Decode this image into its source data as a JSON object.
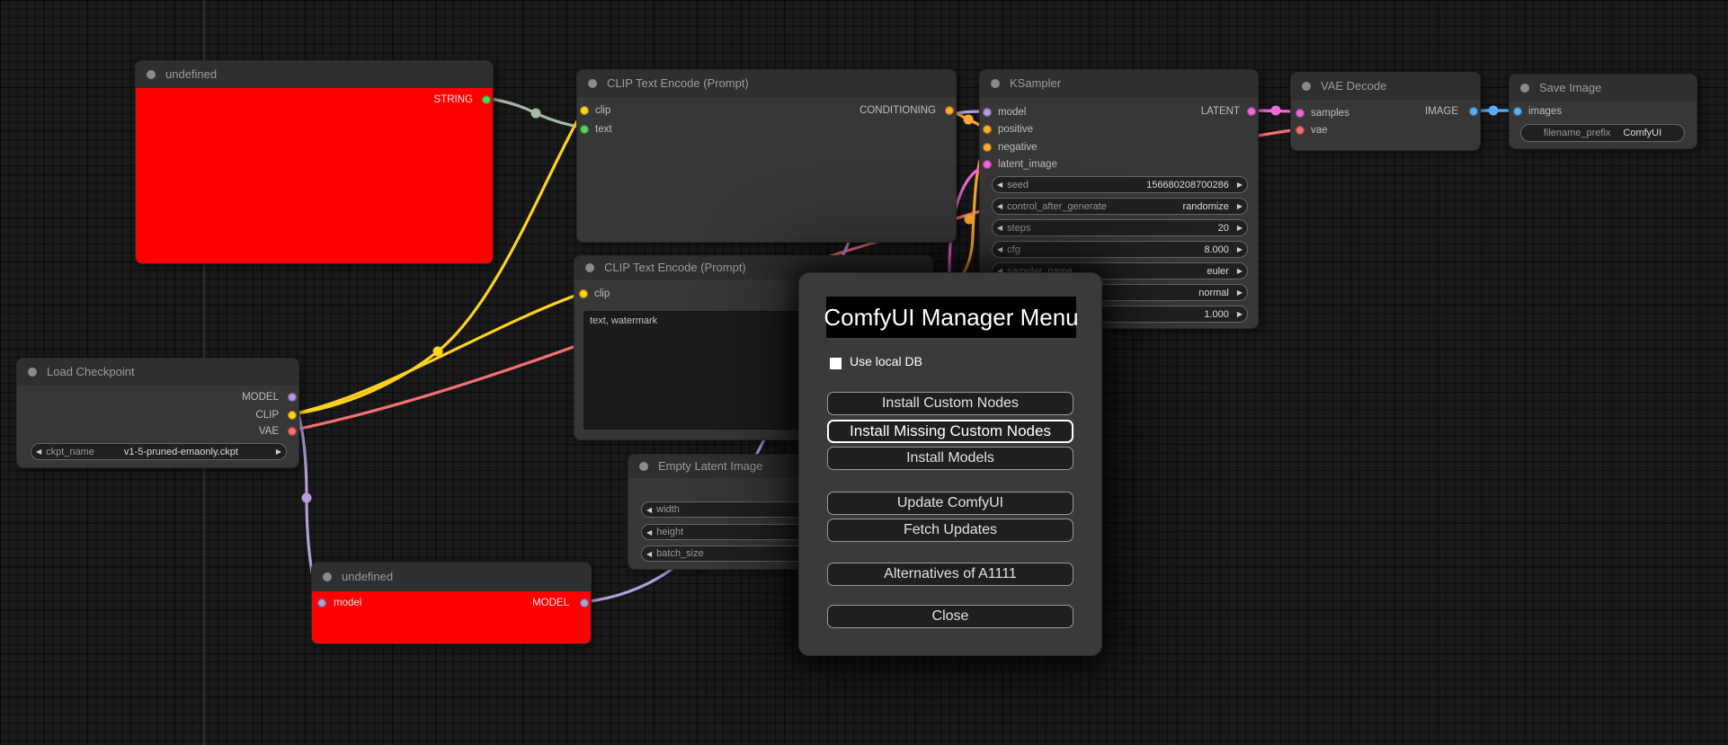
{
  "canvas": {
    "bg": "#1a1a1a",
    "axis_line_color": "#31415f"
  },
  "colors": {
    "model": "#b39ddb",
    "clip": "#ffd21e",
    "conditioning": "#ffa931",
    "latent": "#f368d8",
    "vae": "#f87070",
    "image": "#58b0f2",
    "string": "#58d558",
    "string_wire": "#a6b8a6",
    "node_bg": "#373737",
    "node_title_bg": "#2f2f2f",
    "error_node_bg": "#ff0000"
  },
  "icons": {
    "arrow_left": "◀",
    "arrow_right": "▶"
  },
  "nodes": {
    "undefined_top": {
      "title": "undefined",
      "outputs": {
        "0": "STRING"
      }
    },
    "clip_encode_1": {
      "title": "CLIP Text Encode (Prompt)",
      "inputs": {
        "0": "clip",
        "1": "text"
      },
      "outputs": {
        "0": "CONDITIONING"
      }
    },
    "clip_encode_2": {
      "title": "CLIP Text Encode (Prompt)",
      "inputs": {
        "0": "clip"
      },
      "textarea": "text, watermark"
    },
    "ksampler": {
      "title": "KSampler",
      "inputs": {
        "0": "model",
        "1": "positive",
        "2": "negative",
        "3": "latent_image"
      },
      "outputs": {
        "0": "LATENT"
      },
      "widgets": [
        {
          "label": "seed",
          "value": "156680208700286"
        },
        {
          "label": "control_after_generate",
          "value": "randomize"
        },
        {
          "label": "steps",
          "value": "20"
        },
        {
          "label": "cfg",
          "value": "8.000"
        },
        {
          "label": "sampler_name",
          "value": "euler"
        },
        {
          "label": "",
          "value": "normal"
        },
        {
          "label": "",
          "value": "1.000"
        }
      ]
    },
    "vae_decode": {
      "title": "VAE Decode",
      "inputs": {
        "0": "samples",
        "1": "vae"
      },
      "outputs": {
        "0": "IMAGE"
      }
    },
    "save_image": {
      "title": "Save Image",
      "inputs": {
        "0": "images"
      },
      "widgets": [
        {
          "label": "filename_prefix",
          "value": "ComfyUI"
        }
      ]
    },
    "load_checkpoint": {
      "title": "Load Checkpoint",
      "outputs": {
        "0": "MODEL",
        "1": "CLIP",
        "2": "VAE"
      },
      "widgets": [
        {
          "label": "ckpt_name",
          "value": "v1-5-pruned-emaonly.ckpt"
        }
      ]
    },
    "empty_latent": {
      "title": "Empty Latent Image",
      "widgets": [
        {
          "label": "width",
          "value": ""
        },
        {
          "label": "height",
          "value": ""
        },
        {
          "label": "batch_size",
          "value": ""
        }
      ]
    },
    "undefined_bottom": {
      "title": "undefined",
      "inputs": {
        "0": "model"
      },
      "outputs": {
        "0": "MODEL"
      }
    }
  },
  "dialog": {
    "title": "ComfyUI Manager Menu",
    "checkbox_label": "Use local DB",
    "checkbox_checked": false,
    "buttons": {
      "0": "Install Custom Nodes",
      "1": "Install Missing Custom Nodes",
      "2": "Install Models",
      "3": "Update ComfyUI",
      "4": "Fetch Updates",
      "5": "Alternatives of A1111",
      "6": "Close"
    },
    "highlighted_button": "Install Missing Custom Nodes"
  }
}
